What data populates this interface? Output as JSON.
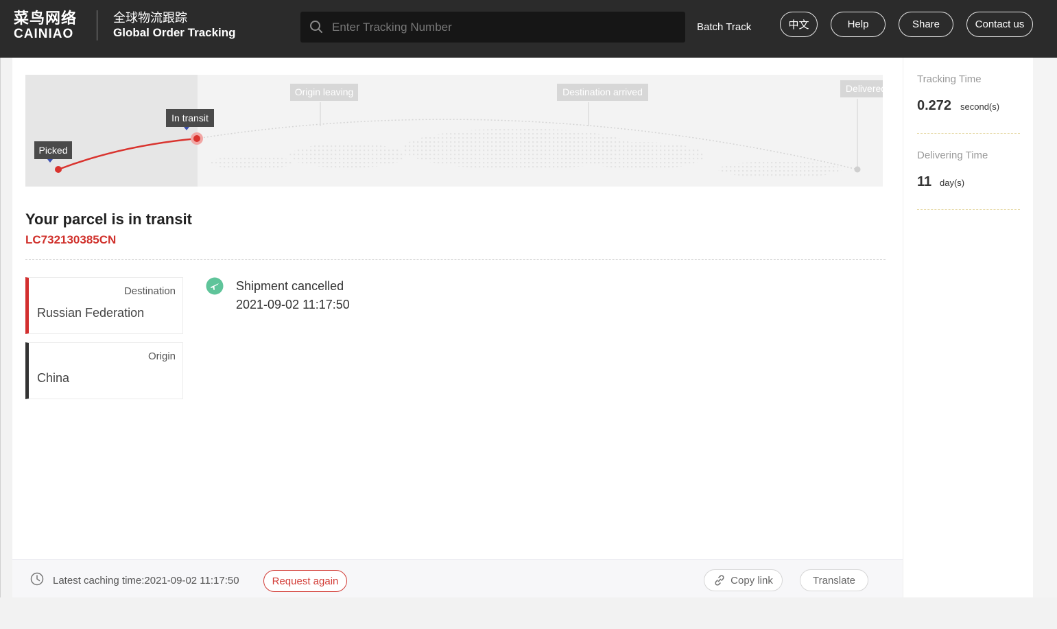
{
  "header": {
    "logo_cn": "菜鸟网络",
    "logo_en": "CAINIAO",
    "title_cn": "全球物流跟踪",
    "title_en": "Global Order Tracking",
    "search_placeholder": "Enter Tracking Number",
    "batch_track": "Batch Track",
    "lang_button": "中文",
    "help_button": "Help",
    "share_button": "Share",
    "contact_button": "Contact us"
  },
  "progress": {
    "stages": [
      "Picked",
      "In transit",
      "Origin leaving",
      "Destination arrived",
      "Delivered"
    ],
    "current_stage": "In transit",
    "accent_color": "#d9332e"
  },
  "parcel": {
    "status": "Your parcel is in transit",
    "tracking_number": "LC732130385CN"
  },
  "locations": {
    "destination_label": "Destination",
    "destination_value": "Russian Federation",
    "origin_label": "Origin",
    "origin_value": "China"
  },
  "event": {
    "icon": "airplane-icon",
    "description": "Shipment cancelled",
    "time": "2021-09-02 11:17:50"
  },
  "footer": {
    "cache_text": "Latest caching time:2021-09-02 11:17:50",
    "request_again": "Request again",
    "copy_link": "Copy link",
    "translate": "Translate"
  },
  "side": {
    "tracking_time_label": "Tracking Time",
    "tracking_time_value": "0.272",
    "tracking_time_unit": "second(s)",
    "delivering_time_label": "Delivering Time",
    "delivering_time_value": "11",
    "delivering_time_unit": "day(s)"
  }
}
